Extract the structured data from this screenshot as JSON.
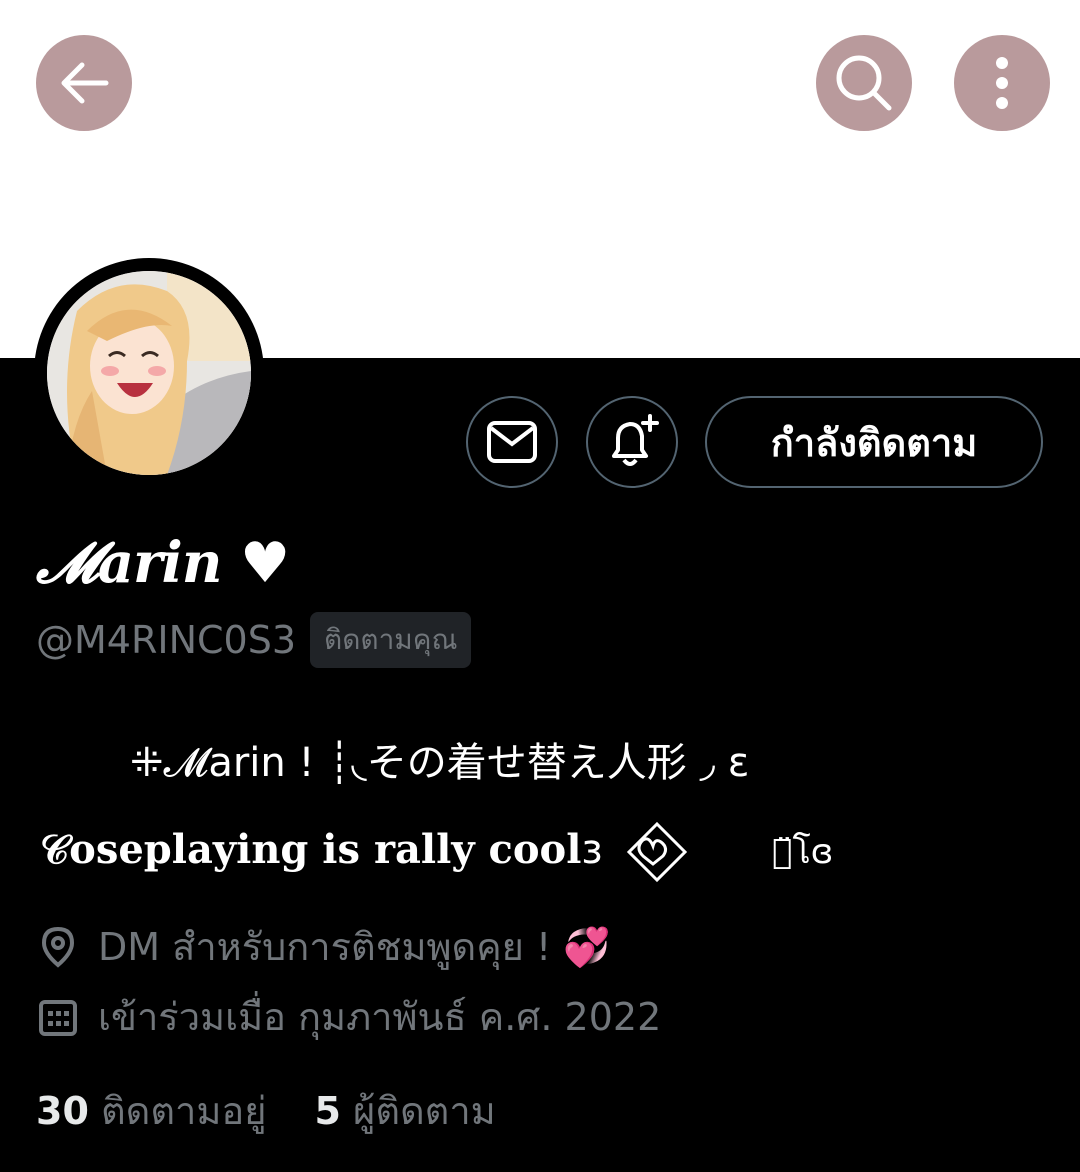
{
  "header": {
    "back_icon": "arrow-left-icon",
    "search_icon": "search-icon",
    "more_icon": "more-vertical-icon",
    "button_color": "#b99a9c"
  },
  "profile": {
    "avatar_alt": "avatar",
    "display_name": "𝓜arin ♥",
    "handle": "@M4RINC0S3",
    "follows_you": "ติดตามคุณ",
    "follow_button": "กำลังติดตาม",
    "bio_line1": "⁜𝓜arin ! ┊◟その着せ替え人形 ◞ ε",
    "bio_line2_a": "𝒞oseplaying is rally cool",
    "bio_line2_b": "ɜ",
    "bio_line2_c": "อ̈โɞ",
    "location": "DM สำหรับการติชมพูดคุย ! 💞",
    "joined": "เข้าร่วมเมื่อ กุมภาพันธ์ ค.ศ. 2022"
  },
  "stats": {
    "following_count": "30",
    "following_label": "ติดตามอยู่",
    "followers_count": "5",
    "followers_label": "ผู้ติดตาม"
  }
}
